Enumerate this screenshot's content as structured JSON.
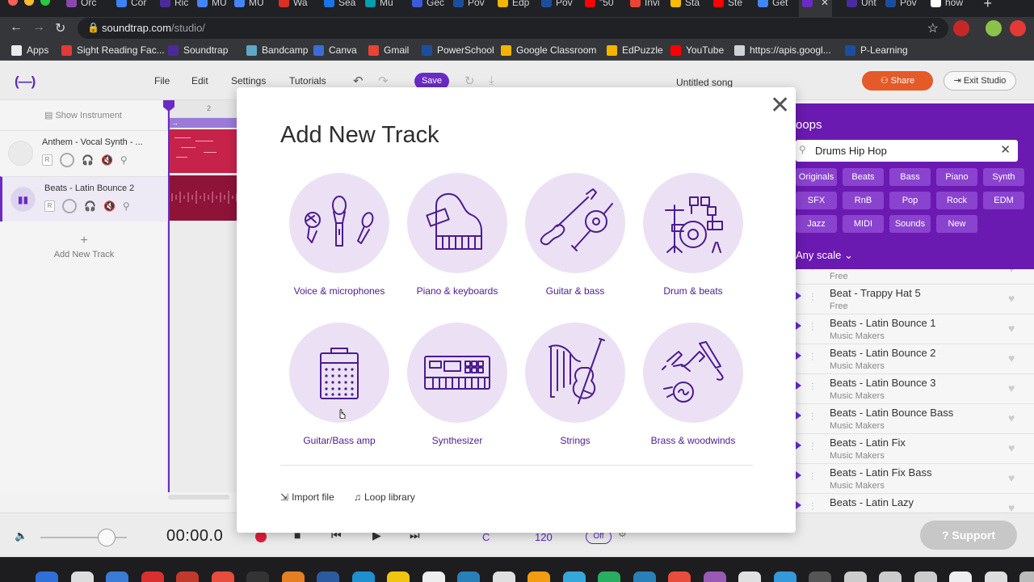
{
  "browser": {
    "tabs": [
      {
        "title": "Orc",
        "color": "#8e44ad"
      },
      {
        "title": "Cor",
        "color": "#3b82f6"
      },
      {
        "title": "Ric",
        "color": "#4b2a9b"
      },
      {
        "title": "MU",
        "color": "#4285f4"
      },
      {
        "title": "MU",
        "color": "#4285f4"
      },
      {
        "title": "Wa",
        "color": "#d93025"
      },
      {
        "title": "Sea",
        "color": "#1a73e8"
      },
      {
        "title": "Mu",
        "color": "#00a0b0"
      },
      {
        "title": "Gec",
        "color": "#3b5bdb"
      },
      {
        "title": "Pov",
        "color": "#1a4fa0"
      },
      {
        "title": "Edp",
        "color": "#f4b400"
      },
      {
        "title": "Pov",
        "color": "#1a4fa0"
      },
      {
        "title": "\"50",
        "color": "#ff0000"
      },
      {
        "title": "Invi",
        "color": "#ea4335"
      },
      {
        "title": "Sta",
        "color": "#fbbc04"
      },
      {
        "title": "Ste",
        "color": "#ff0000"
      },
      {
        "title": "Get",
        "color": "#4285f4"
      },
      {
        "title": "",
        "color": "#6a2bc4"
      },
      {
        "title": "Unt",
        "color": "#4b2a9b"
      },
      {
        "title": "Pov",
        "color": "#1a4fa0"
      },
      {
        "title": "how",
        "color": "#ffffff"
      }
    ],
    "new_tab": "+",
    "url_host": "soundtrap.com",
    "url_path": "/studio/",
    "bookmarks": [
      {
        "label": "Apps",
        "icon": "apps-grid-icon",
        "color": "#e8eaed"
      },
      {
        "label": "Sight Reading Fac...",
        "icon": "srf-icon",
        "color": "#e53935"
      },
      {
        "label": "Soundtrap",
        "icon": "soundtrap-icon",
        "color": "#4b2a9b"
      },
      {
        "label": "Bandcamp",
        "icon": "bandcamp-icon",
        "color": "#5fa7c8"
      },
      {
        "label": "Canva",
        "icon": "canva-icon",
        "color": "#3c6cd8"
      },
      {
        "label": "Gmail",
        "icon": "gmail-icon",
        "color": "#ea4335"
      },
      {
        "label": "PowerSchool",
        "icon": "powerschool-icon",
        "color": "#1a4fa0"
      },
      {
        "label": "Google Classroom",
        "icon": "classroom-icon",
        "color": "#f4b400"
      },
      {
        "label": "EdPuzzle",
        "icon": "edpuzzle-icon",
        "color": "#f4b400"
      },
      {
        "label": "YouTube",
        "icon": "youtube-icon",
        "color": "#ff0000"
      },
      {
        "label": "https://apis.googl...",
        "icon": "globe-icon",
        "color": "#cfd3d8"
      },
      {
        "label": "P-Learning",
        "icon": "powerschool-icon",
        "color": "#1a4fa0"
      }
    ]
  },
  "header": {
    "menu": [
      "File",
      "Edit",
      "Settings",
      "Tutorials"
    ],
    "save_label": "Save",
    "song_title": "Untitled song",
    "share_label": "Share",
    "exit_label": "Exit Studio"
  },
  "sidebar": {
    "show_instrument": "Show Instrument",
    "tracks": [
      {
        "name": "Anthem - Vocal Synth - ...",
        "r": "R",
        "vol": "Vol"
      },
      {
        "name": "Beats - Latin Bounce 2",
        "r": "R",
        "vol": "Vol"
      }
    ],
    "add_track": "Add New Track"
  },
  "timeline": {
    "ruler_mark": "2",
    "loop_arrow": "→"
  },
  "transport": {
    "time": "00:00.0",
    "key": "C",
    "tempo": "120",
    "metronome": "Off",
    "support": "Support"
  },
  "loops": {
    "title": "oops",
    "search_value": "Drums Hip Hop",
    "chips": [
      "Originals",
      "Beats",
      "Bass",
      "Piano",
      "Synth",
      "SFX",
      "RnB",
      "Pop",
      "Rock",
      "EDM",
      "Jazz",
      "MIDI",
      "Sounds",
      "New"
    ],
    "scale": "Any scale",
    "items": [
      {
        "name": "",
        "sub": "Free"
      },
      {
        "name": "Beat - Trappy Hat 5",
        "sub": "Free"
      },
      {
        "name": "Beats - Latin Bounce 1",
        "sub": "Music Makers"
      },
      {
        "name": "Beats - Latin Bounce 2",
        "sub": "Music Makers"
      },
      {
        "name": "Beats - Latin Bounce 3",
        "sub": "Music Makers"
      },
      {
        "name": "Beats - Latin Bounce Bass",
        "sub": "Music Makers"
      },
      {
        "name": "Beats - Latin Fix",
        "sub": "Music Makers"
      },
      {
        "name": "Beats - Latin Fix Bass",
        "sub": "Music Makers"
      },
      {
        "name": "Beats - Latin Lazy",
        "sub": ""
      }
    ]
  },
  "modal": {
    "title": "Add New Track",
    "close": "✕",
    "options": [
      {
        "label": "Voice & microphones",
        "icon": "microphones-icon"
      },
      {
        "label": "Piano & keyboards",
        "icon": "piano-icon"
      },
      {
        "label": "Guitar & bass",
        "icon": "guitars-icon"
      },
      {
        "label": "Drum & beats",
        "icon": "drum-kit-icon"
      },
      {
        "label": "Guitar/Bass amp",
        "icon": "amp-icon"
      },
      {
        "label": "Synthesizer",
        "icon": "synthesizer-icon"
      },
      {
        "label": "Strings",
        "icon": "strings-icon"
      },
      {
        "label": "Brass & woodwinds",
        "icon": "brass-icon"
      }
    ],
    "import_file": "Import file",
    "loop_library": "Loop library"
  },
  "colors": {
    "brand_purple": "#6a2bc4",
    "share_orange": "#e45a28",
    "circle_bg": "#ece1f4",
    "icon_stroke": "#4b1d90"
  }
}
